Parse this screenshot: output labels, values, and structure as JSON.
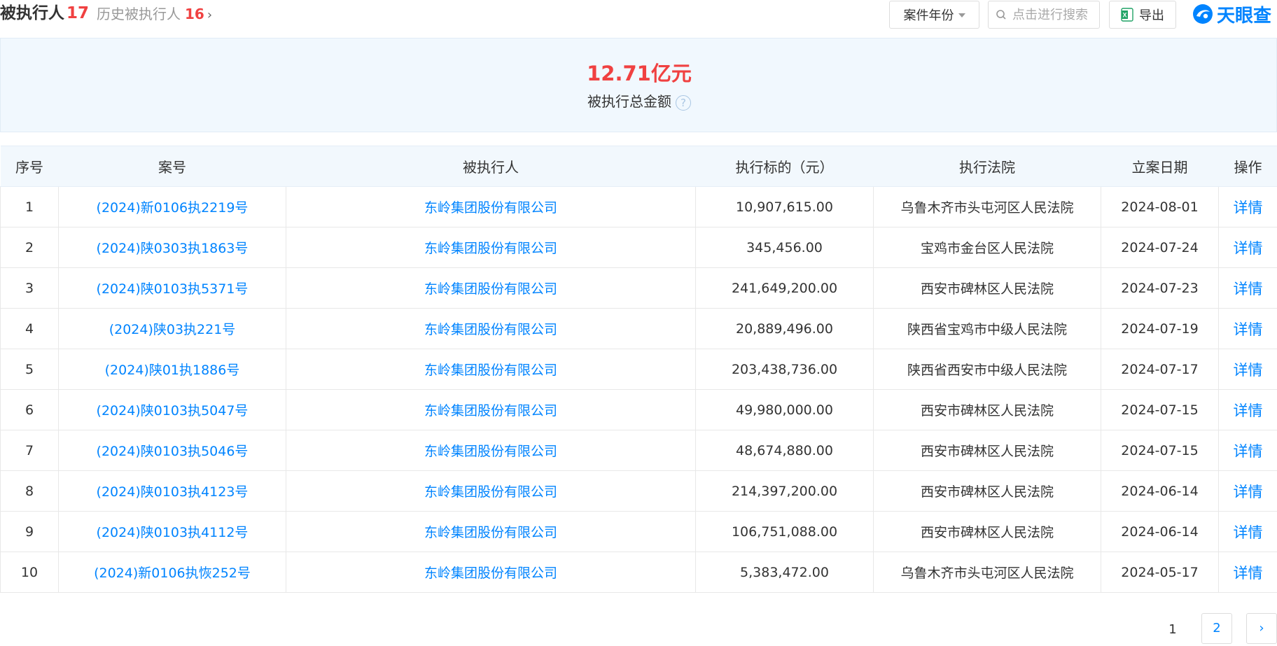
{
  "header": {
    "current_label": "被执行人",
    "current_count": "17",
    "history_label": "历史被执行人",
    "history_count": "16",
    "year_filter_label": "案件年份",
    "search_placeholder": "点击进行搜索",
    "export_label": "导出",
    "logo_text": "天眼查"
  },
  "summary": {
    "amount": "12.71亿元",
    "label": "被执行总金额"
  },
  "table": {
    "columns": [
      "序号",
      "案号",
      "被执行人",
      "执行标的（元）",
      "执行法院",
      "立案日期",
      "操作"
    ],
    "rows": [
      {
        "no": "1",
        "case": "(2024)新0106执2219号",
        "party": "东岭集团股份有限公司",
        "amount": "10,907,615.00",
        "court": "乌鲁木齐市头屯河区人民法院",
        "date": "2024-08-01",
        "action": "详情"
      },
      {
        "no": "2",
        "case": "(2024)陕0303执1863号",
        "party": "东岭集团股份有限公司",
        "amount": "345,456.00",
        "court": "宝鸡市金台区人民法院",
        "date": "2024-07-24",
        "action": "详情"
      },
      {
        "no": "3",
        "case": "(2024)陕0103执5371号",
        "party": "东岭集团股份有限公司",
        "amount": "241,649,200.00",
        "court": "西安市碑林区人民法院",
        "date": "2024-07-23",
        "action": "详情"
      },
      {
        "no": "4",
        "case": "(2024)陕03执221号",
        "party": "东岭集团股份有限公司",
        "amount": "20,889,496.00",
        "court": "陕西省宝鸡市中级人民法院",
        "date": "2024-07-19",
        "action": "详情"
      },
      {
        "no": "5",
        "case": "(2024)陕01执1886号",
        "party": "东岭集团股份有限公司",
        "amount": "203,438,736.00",
        "court": "陕西省西安市中级人民法院",
        "date": "2024-07-17",
        "action": "详情"
      },
      {
        "no": "6",
        "case": "(2024)陕0103执5047号",
        "party": "东岭集团股份有限公司",
        "amount": "49,980,000.00",
        "court": "西安市碑林区人民法院",
        "date": "2024-07-15",
        "action": "详情"
      },
      {
        "no": "7",
        "case": "(2024)陕0103执5046号",
        "party": "东岭集团股份有限公司",
        "amount": "48,674,880.00",
        "court": "西安市碑林区人民法院",
        "date": "2024-07-15",
        "action": "详情"
      },
      {
        "no": "8",
        "case": "(2024)陕0103执4123号",
        "party": "东岭集团股份有限公司",
        "amount": "214,397,200.00",
        "court": "西安市碑林区人民法院",
        "date": "2024-06-14",
        "action": "详情"
      },
      {
        "no": "9",
        "case": "(2024)陕0103执4112号",
        "party": "东岭集团股份有限公司",
        "amount": "106,751,088.00",
        "court": "西安市碑林区人民法院",
        "date": "2024-06-14",
        "action": "详情"
      },
      {
        "no": "10",
        "case": "(2024)新0106执恢252号",
        "party": "东岭集团股份有限公司",
        "amount": "5,383,472.00",
        "court": "乌鲁木齐市头屯河区人民法院",
        "date": "2024-05-17",
        "action": "详情"
      }
    ]
  },
  "pagination": {
    "page1": "1",
    "page2": "2",
    "next": "›"
  },
  "colors": {
    "accent": "#0084ff",
    "highlight": "#f04141",
    "summary_bg": "#f1f8fe"
  }
}
